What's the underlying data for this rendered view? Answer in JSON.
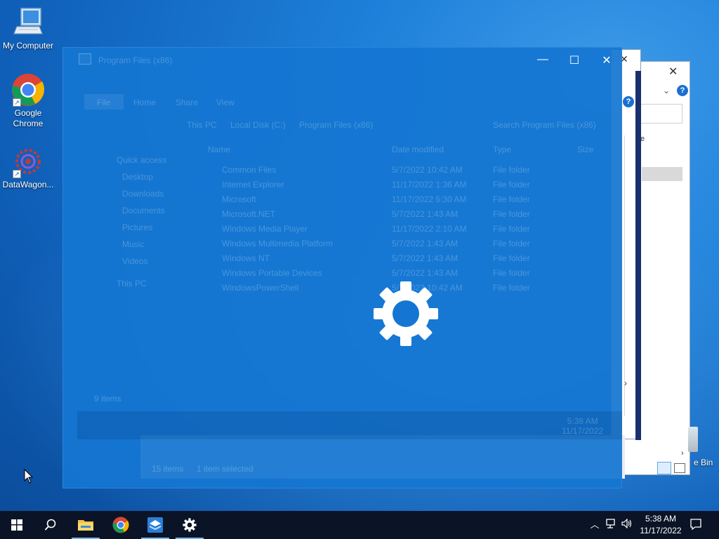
{
  "desktop": {
    "icons": [
      {
        "label": "My Computer",
        "icon": "computer-icon"
      },
      {
        "label": "Google Chrome",
        "icon": "chrome-icon"
      },
      {
        "label": "DataWagon...",
        "icon": "datawagon-icon"
      }
    ],
    "recycle_bin_label_fragment": "e Bin"
  },
  "overlay": {
    "ghost_title": "Program Files (x86)",
    "ghost_ribbon_tabs": [
      "File",
      "Home",
      "Share",
      "View"
    ],
    "ghost_breadcrumb": [
      "This PC",
      "Local Disk (C:)",
      "Program Files (x86)"
    ],
    "ghost_search_placeholder": "Search Program Files (x86)",
    "ghost_columns": [
      "Name",
      "Date modified",
      "Type",
      "Size"
    ],
    "ghost_nav": [
      "Quick access",
      "Desktop",
      "Downloads",
      "Documents",
      "Pictures",
      "Music",
      "Videos",
      "This PC"
    ],
    "ghost_files": [
      {
        "name": "Common Files",
        "date": "5/7/2022 10:42 AM",
        "type": "File folder"
      },
      {
        "name": "Internet Explorer",
        "date": "11/17/2022 1:36 AM",
        "type": "File folder"
      },
      {
        "name": "Microsoft",
        "date": "11/17/2022 5:30 AM",
        "type": "File folder"
      },
      {
        "name": "Microsoft.NET",
        "date": "5/7/2022 1:43 AM",
        "type": "File folder"
      },
      {
        "name": "Windows Media Player",
        "date": "11/17/2022 2:10 AM",
        "type": "File folder"
      },
      {
        "name": "Windows Multimedia Platform",
        "date": "5/7/2022 1:43 AM",
        "type": "File folder"
      },
      {
        "name": "Windows NT",
        "date": "5/7/2022 1:43 AM",
        "type": "File folder"
      },
      {
        "name": "Windows Portable Devices",
        "date": "5/7/2022 1:43 AM",
        "type": "File folder"
      },
      {
        "name": "WindowsPowerShell",
        "date": "5/7/2022 10:42 AM",
        "type": "File folder"
      }
    ],
    "ghost_status": "9 items",
    "ghost_status_back": [
      "15 items",
      "1 item selected"
    ],
    "ghost_clock": [
      "5:38 AM",
      "11/17/2022"
    ]
  },
  "taskbar": {
    "buttons": [
      {
        "name": "start-button",
        "icon": "windows-logo-icon"
      },
      {
        "name": "search-button",
        "icon": "search-icon"
      },
      {
        "name": "taskbar-file-explorer",
        "icon": "folder-icon"
      },
      {
        "name": "taskbar-chrome",
        "icon": "chrome-icon"
      },
      {
        "name": "taskbar-datawagon",
        "icon": "datawagon-icon"
      },
      {
        "name": "taskbar-settings",
        "icon": "gear-icon"
      }
    ],
    "clock_time": "5:38 AM",
    "clock_date": "11/17/2022"
  },
  "colors": {
    "accent": "#1476d2",
    "taskbar": "#0a1426",
    "chrome_red": "#db4437",
    "chrome_green": "#0f9d58",
    "chrome_yellow": "#f4b400",
    "chrome_blue": "#4285f4"
  }
}
